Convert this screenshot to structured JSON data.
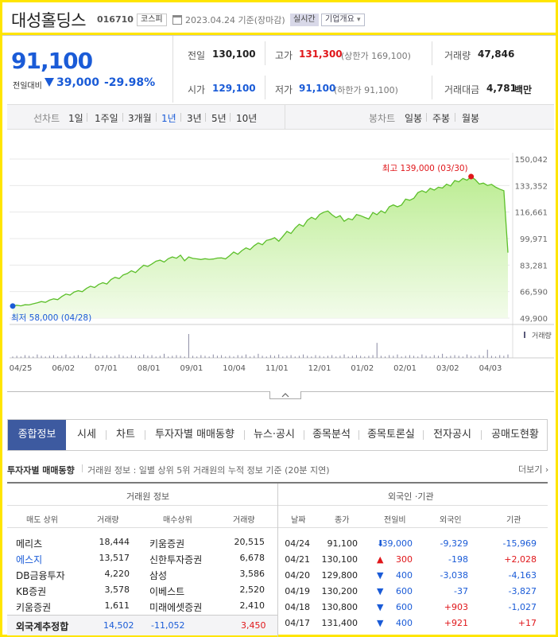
{
  "header": {
    "stock_name": "대성홀딩스",
    "stock_code": "016710",
    "market_badge": "코스피",
    "date_text": "2023.04.24 기준(장마감)",
    "realtime_label": "실시간",
    "overview_label": "기업개요",
    "overview_chevron": "▾"
  },
  "price": {
    "current": "91,100",
    "change_label": "전일대비",
    "change_value": "39,000",
    "change_pct": "-29.98%",
    "direction": "down"
  },
  "stats": {
    "prev_close_label": "전일",
    "prev_close": "130,100",
    "high_label": "고가",
    "high": "131,300",
    "upper_limit": "(상한가 169,100)",
    "volume_label": "거래량",
    "volume": "47,846",
    "open_label": "시가",
    "open": "129,100",
    "low_label": "저가",
    "low": "91,100",
    "lower_limit": "(하한가 91,100)",
    "amount_label": "거래대금",
    "amount": "4,781",
    "amount_unit": "백만"
  },
  "period_bar": {
    "line_chart_label": "선차트",
    "line_options": [
      "1일",
      "1주일",
      "3개월",
      "1년",
      "3년",
      "5년",
      "10년"
    ],
    "active_line_option": "1년",
    "candle_label": "봉차트",
    "candle_options": [
      "일봉",
      "주봉",
      "월봉"
    ]
  },
  "chart_data": {
    "type": "area",
    "y_ticks": [
      "150,042",
      "133,352",
      "116,661",
      "99,971",
      "83,281",
      "66,590",
      "49,900"
    ],
    "ylim": [
      49900,
      150042
    ],
    "x_ticks": [
      "04/25",
      "06/02",
      "07/01",
      "08/01",
      "09/01",
      "10/04",
      "11/01",
      "12/01",
      "01/02",
      "02/01",
      "03/02",
      "04/03"
    ],
    "high_label": "최고 139,000 (03/30)",
    "low_label": "최저 58,000 (04/28)",
    "volume_legend": "거래량",
    "series": [
      {
        "values": [
          57500,
          58000,
          57600,
          58300,
          58200,
          58900,
          59500,
          60300,
          59800,
          61200,
          62000,
          61500,
          63500,
          65000,
          64400,
          66300,
          67100,
          66500,
          68600,
          70000,
          69200,
          71100,
          72200,
          71400,
          74200,
          75600,
          74800,
          77100,
          78000,
          79700,
          78600,
          81000,
          83200,
          82400,
          84000,
          85700,
          86400,
          85200,
          87300,
          88400,
          87600,
          89500,
          86000,
          88400,
          87500,
          87200,
          86800,
          87300,
          86900,
          87100,
          87700,
          87800,
          87200,
          89200,
          91500,
          90100,
          92400,
          94100,
          93000,
          95500,
          97200,
          96100,
          98800,
          99400,
          100500,
          98300,
          101300,
          104500,
          103200,
          106600,
          109000,
          107700,
          111500,
          113400,
          112100,
          115200,
          116600,
          117300,
          115000,
          113200,
          114400,
          110900,
          112600,
          111800,
          115100,
          114400,
          113300,
          112300,
          116400,
          115000,
          117500,
          116100,
          120000,
          121200,
          120000,
          121100,
          124800,
          124100,
          125300,
          128900,
          130100,
          129000,
          131600,
          130500,
          132300,
          131800,
          134200,
          133100,
          136500,
          135700,
          137800,
          136700,
          139000,
          137100,
          134300,
          134900,
          133400,
          134100,
          132300,
          131100,
          130100,
          91100
        ]
      }
    ],
    "volume": [
      2,
      3,
      2,
      4,
      3,
      2,
      5,
      3,
      2,
      3,
      4,
      2,
      3,
      5,
      2,
      3,
      4,
      3,
      2,
      6,
      3,
      2,
      3,
      4,
      2,
      3,
      5,
      3,
      2,
      4,
      3,
      2,
      5,
      3,
      4,
      2,
      3,
      6,
      2,
      3,
      4,
      3,
      2,
      35,
      3,
      2,
      4,
      3,
      2,
      5,
      3,
      4,
      2,
      3,
      2,
      4,
      3,
      5,
      2,
      3,
      6,
      3,
      2,
      4,
      3,
      5,
      2,
      3,
      4,
      2,
      3,
      5,
      3,
      2,
      4,
      3,
      2,
      3,
      4,
      2,
      3,
      5,
      2,
      3,
      4,
      3,
      2,
      3,
      4,
      22,
      3,
      2,
      4,
      3,
      5,
      2,
      3,
      4,
      3,
      2,
      5,
      3,
      2,
      4,
      3,
      6,
      2,
      3,
      4,
      3,
      2,
      5,
      3,
      2,
      4,
      3,
      12,
      3,
      2,
      4,
      3,
      5
    ]
  },
  "tabs": [
    "종합정보",
    "시세",
    "차트",
    "투자자별 매매동향",
    "뉴스·공시",
    "종목분석",
    "종목토론실",
    "전자공시",
    "공매도현황"
  ],
  "active_tab": "종합정보",
  "section": {
    "title": "투자자별 매매동향",
    "desc": "거래원 정보 : 일별 상위 5위 거래원의 누적 정보 기준 (20분 지연)",
    "more": "더보기 ›"
  },
  "broker_table": {
    "title": "거래원 정보",
    "headers": [
      "매도 상위",
      "거래량",
      "매수상위",
      "거래량"
    ],
    "rows": [
      {
        "sell": "메리츠",
        "sell_vol": "18,444",
        "buy": "키움증권",
        "buy_vol": "20,515",
        "sell_link": false
      },
      {
        "sell": "에스지",
        "sell_vol": "13,517",
        "buy": "신한투자증권",
        "buy_vol": "6,678",
        "sell_link": true
      },
      {
        "sell": "DB금융투자",
        "sell_vol": "4,220",
        "buy": "삼성",
        "buy_vol": "3,586",
        "sell_link": false
      },
      {
        "sell": "KB증권",
        "sell_vol": "3,578",
        "buy": "이베스트",
        "buy_vol": "2,520",
        "sell_link": false
      },
      {
        "sell": "키움증권",
        "sell_vol": "1,611",
        "buy": "미래에셋증권",
        "buy_vol": "2,410",
        "sell_link": false
      }
    ],
    "total_label": "외국계추정합",
    "total_sell": "14,502",
    "total_diff": "-11,052",
    "total_buy": "3,450"
  },
  "foreign_table": {
    "title": "외국인 ·기관",
    "headers": [
      "날짜",
      "종가",
      "전일비",
      "외국인",
      "기관"
    ],
    "rows": [
      {
        "date": "04/24",
        "close": "91,100",
        "arrow": "⬇",
        "change": "39,000",
        "foreign": "-9,329",
        "inst": "-15,969",
        "dir": "down"
      },
      {
        "date": "04/21",
        "close": "130,100",
        "arrow": "▲",
        "change": "300",
        "foreign": "-198",
        "inst": "+2,028",
        "dir": "up"
      },
      {
        "date": "04/20",
        "close": "129,800",
        "arrow": "▼",
        "change": "400",
        "foreign": "-3,038",
        "inst": "-4,163",
        "dir": "down"
      },
      {
        "date": "04/19",
        "close": "130,200",
        "arrow": "▼",
        "change": "600",
        "foreign": "-37",
        "inst": "-3,827",
        "dir": "down"
      },
      {
        "date": "04/18",
        "close": "130,800",
        "arrow": "▼",
        "change": "600",
        "foreign": "+903",
        "inst": "-1,027",
        "dir": "down"
      },
      {
        "date": "04/17",
        "close": "131,400",
        "arrow": "▼",
        "change": "400",
        "foreign": "+921",
        "inst": "+17",
        "dir": "down"
      }
    ]
  },
  "colors": {
    "up": "#e0161a",
    "down": "#1a5bd7",
    "accent_tab": "#3d5aa0",
    "frame": "#ffe500",
    "chart_line": "#5cbf2a",
    "chart_fill": "#c8f0a8"
  }
}
